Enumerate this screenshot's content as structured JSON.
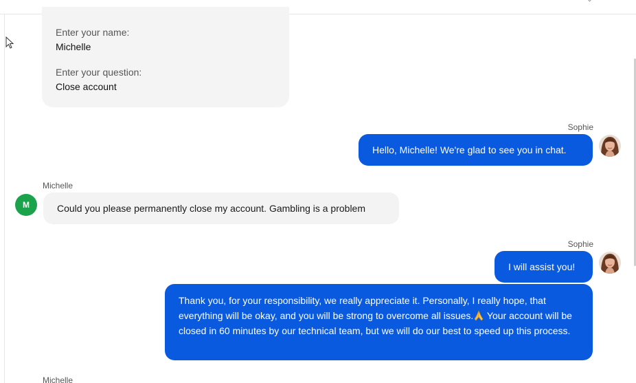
{
  "form": {
    "name_label": "Enter your name:",
    "name_value": "Michelle",
    "question_label": "Enter your question:",
    "question_value": "Close account"
  },
  "messages": [
    {
      "sender": "Sophie",
      "role": "agent",
      "text": "Hello, Michelle! We're glad to see you in chat."
    },
    {
      "sender": "Michelle",
      "role": "user",
      "avatar_initial": "M",
      "text": "Could you please permanently close my account. Gambling is a problem"
    },
    {
      "sender": "Sophie",
      "role": "agent",
      "text": "I will assist you!"
    },
    {
      "sender": "Sophie",
      "role": "agent",
      "text_part1": "Thank you, for your responsibility, we really appreciate it. Personally, I really hope, that everything will be okay, and you will be strong to overcome all issues.",
      "emoji": "folded-hands-icon",
      "text_part2": " Your account will be closed in 60 minutes by our technical team, but we will do our best to speed up this process."
    },
    {
      "sender": "Michelle",
      "role": "user"
    }
  ],
  "colors": {
    "agent_bubble": "#0a5ae0",
    "user_bubble": "#f3f3f3",
    "form_card": "#f4f4f4",
    "user_avatar": "#1aa34a"
  }
}
